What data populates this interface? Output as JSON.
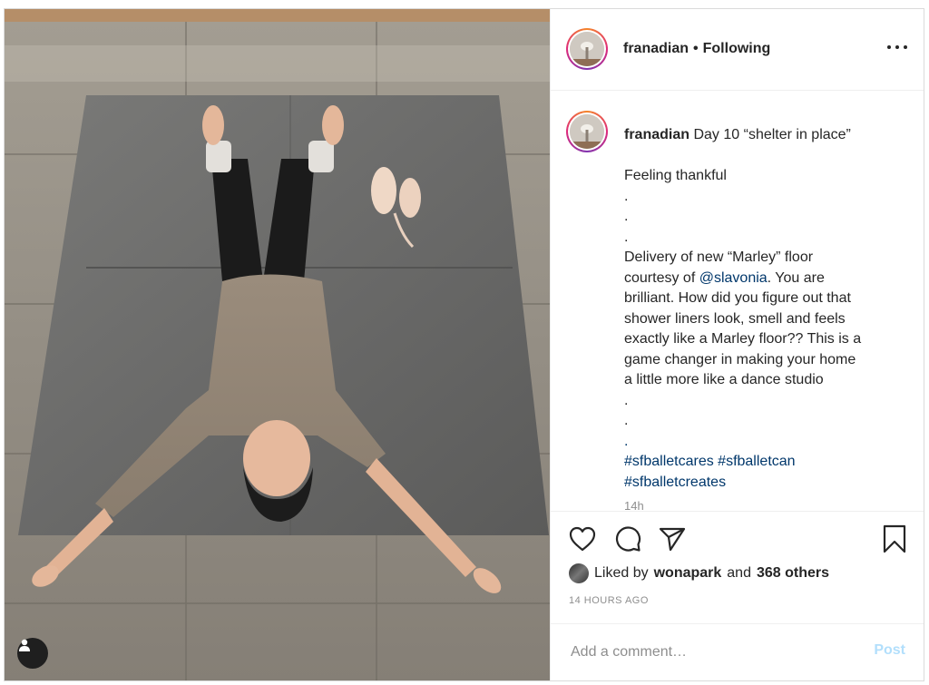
{
  "post": {
    "username": "franadian",
    "follow_status": "Following",
    "separator": "•",
    "photo_alt": "Dancer lying on a grey Marley floor with arms and legs spread, pointe shoes beside",
    "icons": {
      "more": "more-options-icon",
      "like": "heart-icon",
      "comment": "comment-icon",
      "share": "paper-plane-icon",
      "save": "bookmark-icon",
      "tagged": "user-tag-icon"
    }
  },
  "caption": {
    "username": "franadian",
    "title": "Day 10 “shelter in place”",
    "line_thankful": "Feeling thankful",
    "dots": ".",
    "delivery_line1": "Delivery of new “Marley” floor",
    "delivery_prefix": "courtesy of",
    "mention": "@slavonia",
    "delivery_suffix": ". You are",
    "body_lines": [
      "brilliant. How did you figure out that",
      "shower liners look, smell and feels",
      "exactly like a Marley floor?? This is a",
      "game changer in making your home",
      "a little more like a dance studio"
    ],
    "hashtags_line1": "#sfballetcares #sfballetcan",
    "hashtags_line2": "#sfballetcreates",
    "timestamp": "14h"
  },
  "likes": {
    "prefix": "Liked by",
    "user": "wonapark",
    "joiner": "and",
    "others": "368 others"
  },
  "time_ago": "14 HOURS AGO",
  "comment": {
    "placeholder": "Add a comment…",
    "post_label": "Post"
  },
  "colors": {
    "link": "#00376b",
    "muted": "#8e8e8e",
    "post_disabled": "#b2dffc",
    "text": "#262626"
  }
}
